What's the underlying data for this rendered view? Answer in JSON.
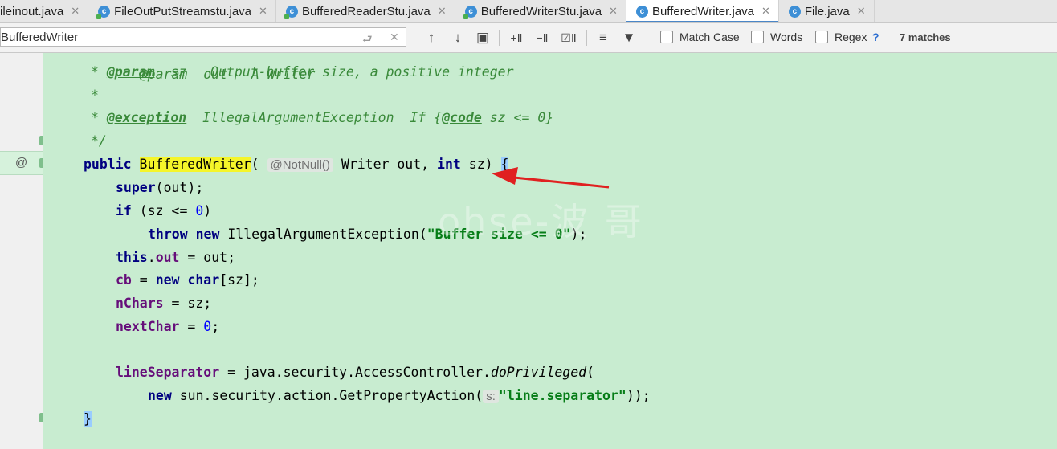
{
  "tabs": [
    {
      "label": "ileinout.java",
      "icon": "none",
      "active": false
    },
    {
      "label": "FileOutPutStreamstu.java",
      "icon": "class-file-icon",
      "active": false
    },
    {
      "label": "BufferedReaderStu.java",
      "icon": "class-file-icon",
      "active": false
    },
    {
      "label": "BufferedWriterStu.java",
      "icon": "class-file-icon",
      "active": false
    },
    {
      "label": "BufferedWriter.java",
      "icon": "class-file-icon",
      "active": true
    },
    {
      "label": "File.java",
      "icon": "class-file-icon",
      "active": false
    }
  ],
  "find": {
    "query": "BufferedWriter",
    "match_case_label": "Match Case",
    "words_label": "Words",
    "regex_label": "Regex",
    "help_label": "?",
    "matches_label": "7 matches",
    "match_case": false,
    "words": false,
    "regex": false
  },
  "gutter": {
    "override_marker": "@"
  },
  "code": {
    "line0": {
      "text": "@param  out   A Writer"
    },
    "line1": {
      "star": "* ",
      "tag": "@param",
      "rest": "  sz   Output-buffer size, a positive integer"
    },
    "line2": {
      "text": "*"
    },
    "line3": {
      "star": "* ",
      "tag": "@exception",
      "mid": "  IllegalArgumentException  If {",
      "code_tag": "@code",
      "rest": " sz <= 0}"
    },
    "line4": {
      "text": "*/"
    },
    "line5": {
      "kw_public": "public",
      "ctor": "BufferedWriter",
      "open": "(",
      "hint": "@NotNull()",
      "params_a": " Writer out, ",
      "kw_int": "int",
      "params_b": " sz) ",
      "brace": "{"
    },
    "line6": {
      "kw_super": "super",
      "rest": "(out);"
    },
    "line7": {
      "kw_if": "if",
      "a": " (sz <= ",
      "num": "0",
      "b": ")"
    },
    "line8": {
      "kw_throw": "throw",
      "sp": " ",
      "kw_new": "new",
      "a": " IllegalArgumentException(",
      "str": "\"Buffer size <= 0\"",
      "b": ");"
    },
    "line9": {
      "kw_this": "this",
      "dot": ".",
      "field": "out",
      "rest": " = out;"
    },
    "line10": {
      "field": "cb",
      "a": " = ",
      "kw_new": "new",
      "sp": " ",
      "kw_char": "char",
      "rest": "[sz];"
    },
    "line11": {
      "field": "nChars",
      "rest": " = sz;"
    },
    "line12": {
      "field": "nextChar",
      "a": " = ",
      "num": "0",
      "b": ";"
    },
    "line13": {
      "field": "lineSeparator",
      "a": " = java.security.AccessController.",
      "method": "doPrivileged",
      "b": "("
    },
    "line14": {
      "kw_new": "new",
      "a": " sun.security.action.GetPropertyAction(",
      "hint": "s:",
      "str": "\"line.separator\"",
      "b": "));"
    },
    "line15": {
      "brace": "}"
    }
  },
  "watermark": "ohse-波 哥",
  "colors": {
    "editor_bg": "#c8ecd0",
    "match_highlight": "#f5f52a",
    "keyword": "#000080",
    "string": "#067d17",
    "annotation_arrow": "#e02020"
  }
}
